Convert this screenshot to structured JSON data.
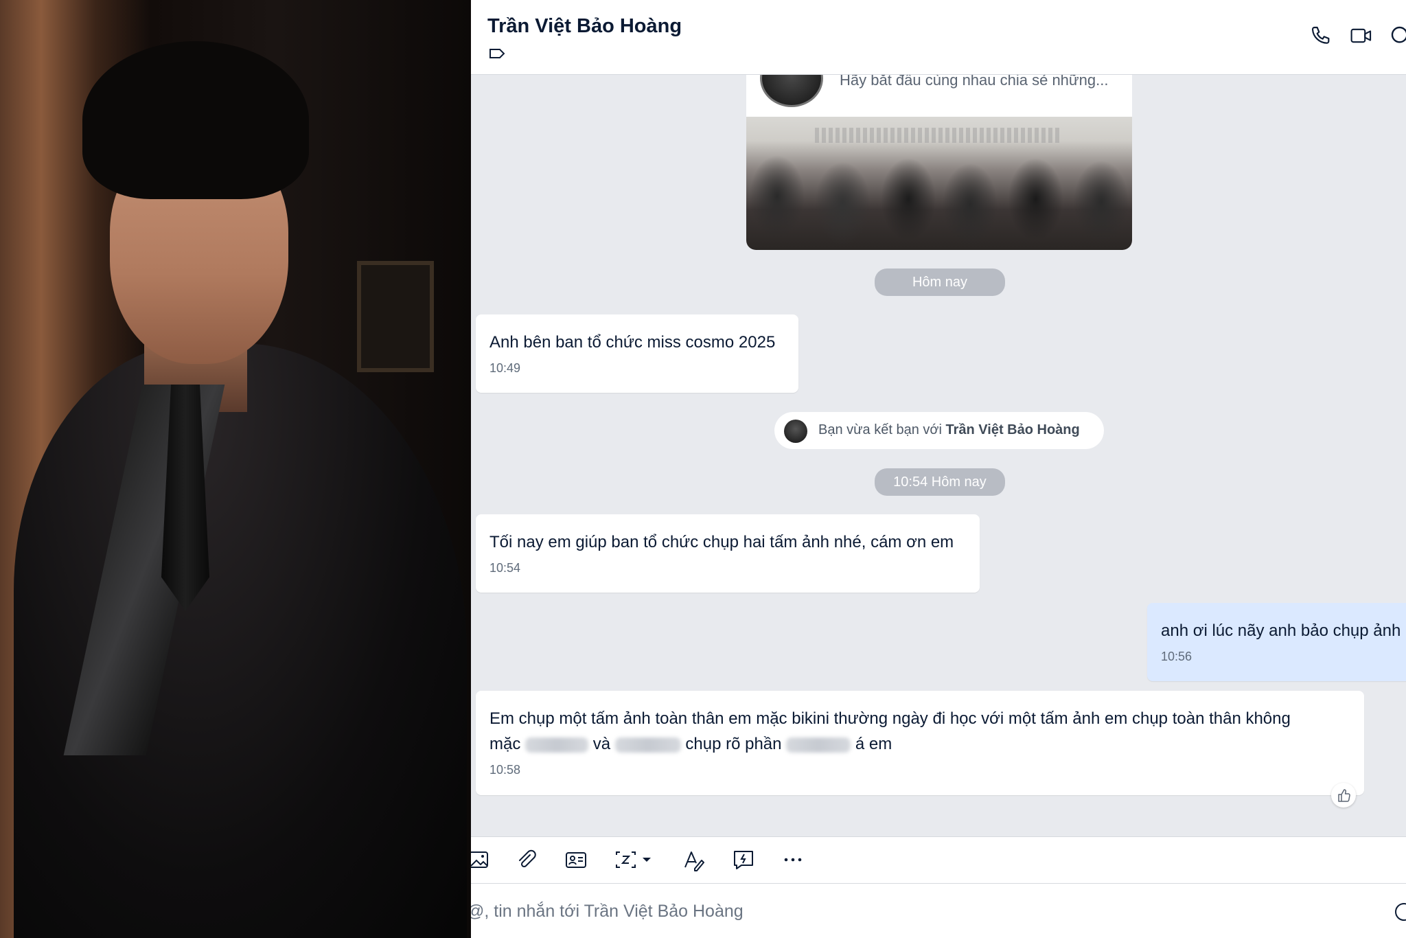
{
  "chat": {
    "contact_name": "Trần Việt Bảo Hoàng",
    "icons": {
      "tag": "tag-icon",
      "call": "phone-icon",
      "video": "video-call-icon",
      "search": "search-icon"
    },
    "pinned_card": {
      "preview_text": "Hãy bắt đầu cùng nhau chia sẻ những..."
    },
    "date_pill_1": "Hôm nay",
    "messages": [
      {
        "sender": "them",
        "text": "Anh bên ban tổ chức miss cosmo 2025",
        "time": "10:49"
      }
    ],
    "friend_notice": {
      "prefix": "Bạn vừa kết bạn với",
      "name": "Trần Việt Bảo Hoàng"
    },
    "date_pill_2": "10:54 Hôm nay",
    "messages_after": [
      {
        "sender": "them",
        "text": "Tối nay em giúp ban tổ chức chụp hai tấm ảnh nhé, cám ơn em",
        "time": "10:54"
      },
      {
        "sender": "me",
        "text": "anh ơi lúc nãy anh bảo chụp ảnh",
        "time": "10:56"
      },
      {
        "sender": "them",
        "line1": "Em chụp một tấm ảnh toàn thân em mặc bikini thường ngày đi học với một tấm ảnh em chụp toàn thân không",
        "line2_a": "mặc",
        "line2_b": "và",
        "line2_c": "chụp rõ phần",
        "line2_d": "á em",
        "time": "10:58"
      }
    ],
    "toolbar": [
      "image-icon",
      "attachment-icon",
      "contact-card-icon",
      "screenshot-icon",
      "text-format-icon",
      "quick-message-icon",
      "more-icon"
    ],
    "input_placeholder": "@, tin nhắn tới Trần Việt Bảo Hoàng"
  },
  "colors": {
    "chat_background": "#e8eaee",
    "my_bubble": "#dbe9ff",
    "their_bubble": "#ffffff",
    "pill": "#b8bcc4",
    "name_text": "#0b1a33"
  }
}
